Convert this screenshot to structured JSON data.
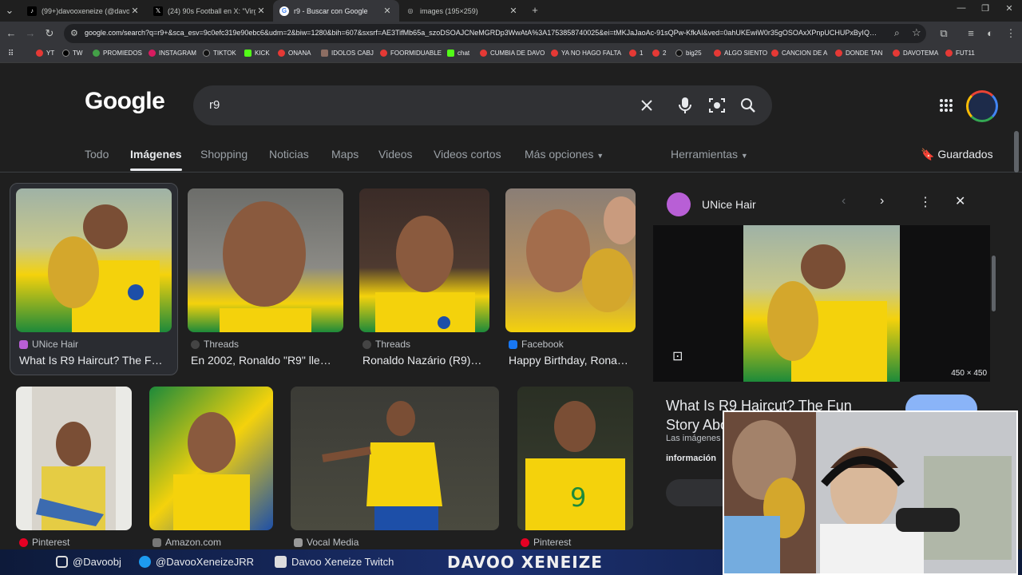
{
  "tabs": [
    {
      "title": "(99+)davooxeneize (@davoox…",
      "icon": "tiktok"
    },
    {
      "title": "(24) 90s Football en X: \"Virgil v…",
      "icon": "x"
    },
    {
      "title": "r9 - Buscar con Google",
      "icon": "google",
      "active": true
    },
    {
      "title": "images (195×259)",
      "icon": "globe"
    }
  ],
  "address_url": "google.com/search?q=r9+&sca_esv=9c0efc319e90ebc6&udm=2&biw=1280&bih=607&sxsrf=AE3TifMb65a_szoDSOAJCNeMGRDp3WwAtA%3A1753858740025&ei=tMKJaJaoAc-91sQPw-KfkAI&ved=0ahUKEwiW0r35gOSOAxXPnpUCHUPxByIQ…",
  "bookmarks": [
    "YT",
    "TW",
    "PROMIEDOS",
    "INSTAGRAM",
    "TIKTOK",
    "KICK",
    "ONANA",
    "IDOLOS CABJ",
    "FOORMIDUABLE",
    "chat",
    "CUMBIA DE DAVO",
    "YA NO HAGO FALTA",
    "1",
    "2",
    "big25",
    "ALGO SIENTO",
    "CANCION DE A",
    "DONDE TAN",
    "DAVOTEMA",
    "FUT11"
  ],
  "logo": "Google",
  "search": {
    "query": "r9"
  },
  "nav": {
    "todo": "Todo",
    "imagenes": "Imágenes",
    "shopping": "Shopping",
    "noticias": "Noticias",
    "maps": "Maps",
    "videos": "Videos",
    "cortos": "Videos cortos",
    "mas": "Más opciones",
    "herramientas": "Herramientas",
    "guardados": "Guardados"
  },
  "results_row1": [
    {
      "source": "UNice Hair",
      "caption": "What Is R9 Haircut? The F…"
    },
    {
      "source": "Threads",
      "caption": "En 2002, Ronaldo \"R9\" lle…"
    },
    {
      "source": "Threads",
      "caption": "Ronaldo Nazário (R9)…"
    },
    {
      "source": "Facebook",
      "caption": "Happy Birthday, Rona…"
    }
  ],
  "results_row2": [
    {
      "source": "Pinterest"
    },
    {
      "source": "Amazon.com"
    },
    {
      "source": "Vocal Media"
    },
    {
      "source": "Pinterest"
    }
  ],
  "panel": {
    "site": "UNice Hair",
    "dims": "450 × 450",
    "title": "What Is R9 Haircut? The Fun Story About Th",
    "note": "Las imágenes",
    "note2": "información"
  },
  "overlay": {
    "instagram": "@Davoobj",
    "twitter": "@DavooXeneizeJRR",
    "youtube": "Davoo Xeneize Twitch",
    "brand": "DAVOO XENEIZE"
  },
  "colors": {
    "brazil_yellow": "#f4d20c",
    "brazil_green": "#1d8a3a",
    "accent_blue": "#8ab4f8"
  }
}
